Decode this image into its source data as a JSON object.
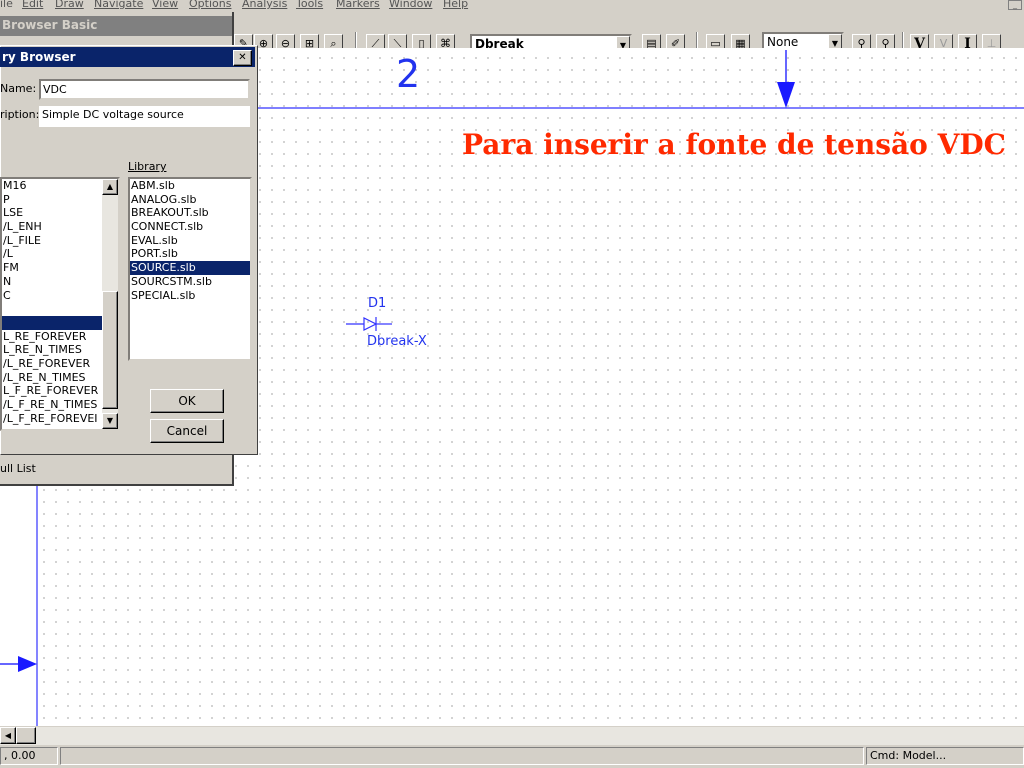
{
  "menu": [
    "ile",
    "Edit",
    "Draw",
    "Navigate",
    "View",
    "Options",
    "Analysis",
    "Tools",
    "Markers",
    "Window",
    "Help"
  ],
  "toolbar": {
    "part_combo": "Dbreak",
    "none_combo": "None",
    "v_label": "V",
    "i_label": "I"
  },
  "schematic": {
    "page_number": "2",
    "annotation": "Para inserir a fonte de tensão VDC",
    "part_ref": "D1",
    "part_value": "Dbreak-X",
    "line_color": "#3333ff",
    "annotation_color": "#ff2a00"
  },
  "back_window": {
    "title": "Browser Basic",
    "checkbox_label": "ull List"
  },
  "dialog": {
    "title": "ry Browser",
    "name_label": "Name:",
    "name_value": "VDC",
    "description_label": "ription:",
    "description_value": "Simple DC voltage source",
    "library_label": "Library",
    "parts": [
      "M16",
      "P",
      "LSE",
      "/L_ENH",
      "/L_FILE",
      "/L",
      "FM",
      "N",
      "C",
      "",
      "",
      "L_RE_FOREVER",
      "L_RE_N_TIMES",
      "/L_RE_FOREVER",
      "/L_RE_N_TIMES",
      "L_F_RE_FOREVER",
      "/L_F_RE_N_TIMES",
      "/L_F_RE_FOREVEI"
    ],
    "parts_selected_index": 10,
    "libraries": [
      "ABM.slb",
      "ANALOG.slb",
      "BREAKOUT.slb",
      "CONNECT.slb",
      "EVAL.slb",
      "PORT.slb",
      "SOURCE.slb",
      "SOURCSTM.slb",
      "SPECIAL.slb"
    ],
    "libraries_selected_index": 6,
    "ok_label": "OK",
    "cancel_label": "Cancel",
    "close_glyph": "✕"
  },
  "status": {
    "coords": ", 0.00",
    "cmd": "Cmd: Model..."
  }
}
